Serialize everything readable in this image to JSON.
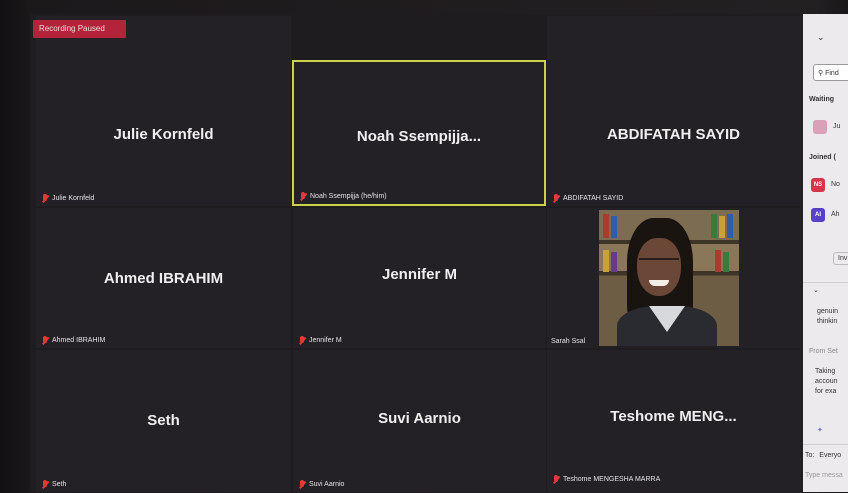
{
  "meeting": {
    "recording_status": "Recording Paused"
  },
  "tiles": [
    {
      "name": "Julie Kornfeld",
      "label": "Julie Kornfeld"
    },
    {
      "name": "Noah  Ssempijja...",
      "label": "Noah Ssempijja (he/him)"
    },
    {
      "name": "ABDIFATAH SAYID",
      "label": "ABDIFATAH SAYID"
    },
    {
      "name": "Ahmed IBRAHIM",
      "label": "Ahmed IBRAHIM"
    },
    {
      "name": "Jennifer M",
      "label": "Jennifer M"
    },
    {
      "name": "",
      "label": "Sarah Ssal"
    },
    {
      "name": "Seth",
      "label": "Seth"
    },
    {
      "name": "Suvi Aarnio",
      "label": "Suvi Aarnio"
    },
    {
      "name": "Teshome  MENG...",
      "label": "Teshome MENGESHA MARRA"
    }
  ],
  "sidebar": {
    "collapse_icon": "chevron-down-icon",
    "search_placeholder": "Find",
    "waiting_heading": "Waiting",
    "waiting_item": "Ju",
    "joined_heading": "Joined (",
    "joined_items": [
      {
        "initials": "NS",
        "text": "No",
        "color": "#d6364a"
      },
      {
        "initials": "AI",
        "text": "Ah",
        "color": "#5a3fc8"
      }
    ],
    "invite_label": "Inv",
    "chat_lines": [
      "genuin",
      "thinkin"
    ],
    "from_label": "From Set",
    "chat_lines2": [
      "Taking",
      "accoun",
      "for exa"
    ],
    "to_label": "To:",
    "to_value": "Everyo",
    "type_message": "Type messa"
  }
}
